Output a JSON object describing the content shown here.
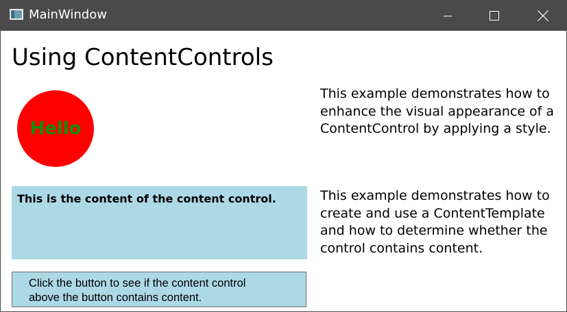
{
  "window": {
    "title": "MainWindow",
    "icon": "app-window-icon",
    "controls": [
      "minimize-icon",
      "maximize-icon",
      "close-icon"
    ],
    "titlebar_color": "#4a4a4a"
  },
  "main": {
    "heading": "Using ContentControls",
    "circle": {
      "text": "Hello",
      "fill_color": "#ff0000",
      "text_color": "#138a13"
    },
    "description_style": "This example demonstrates how to\nenhance the visual appearance of a\nContentControl by applying a style.",
    "content_control": {
      "text": "This is the content of the content control.",
      "background": "#add8e6"
    },
    "description_template": "This example demonstrates how to\ncreate and use a ContentTemplate\nand how to determine whether the\ncontrol contains content.",
    "button": {
      "label": "Click the button to see if the content control\nabove the button contains content."
    }
  }
}
